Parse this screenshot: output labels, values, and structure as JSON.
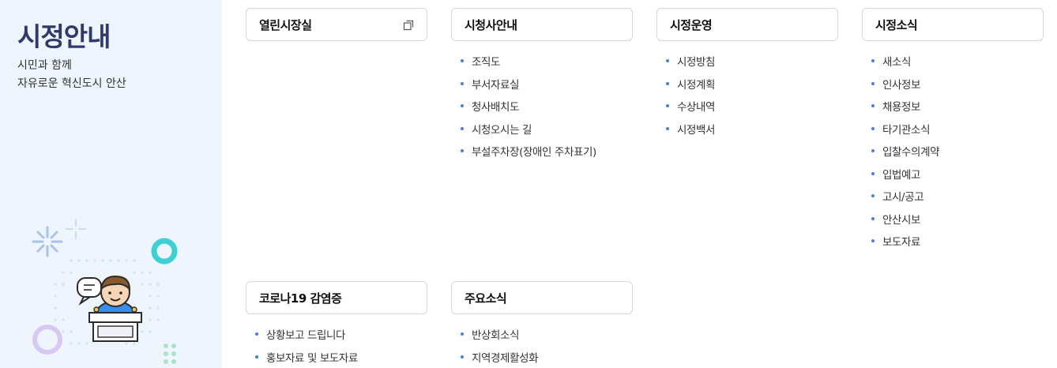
{
  "sidebar": {
    "title": "시정안내",
    "subtitle_line1": "시민과 함께",
    "subtitle_line2": "자유로운 혁신도시 안산"
  },
  "menus": [
    {
      "title": "열린시장실",
      "external": true,
      "items": []
    },
    {
      "title": "시청사안내",
      "items": [
        "조직도",
        "부서자료실",
        "청사배치도",
        "시청오시는 길",
        "부설주차장(장애인 주차표기)"
      ]
    },
    {
      "title": "시정운영",
      "items": [
        "시정방침",
        "시정계획",
        "수상내역",
        "시정백서"
      ]
    },
    {
      "title": "시정소식",
      "items": [
        "새소식",
        "인사정보",
        "채용정보",
        "타기관소식",
        "입찰수의계약",
        "입법예고",
        "고시/공고",
        "안산시보",
        "보도자료"
      ]
    },
    {
      "title": "코로나19 감염증",
      "items": [
        "상황보고 드립니다",
        "홍보자료 및 보도자료"
      ]
    },
    {
      "title": "주요소식",
      "items": [
        "반상회소식",
        "지역경제활성화"
      ]
    }
  ],
  "colors": {
    "sidebar_bg": "#eef5fd",
    "title": "#2f3a6b",
    "bullet": "#4a7fd9"
  }
}
